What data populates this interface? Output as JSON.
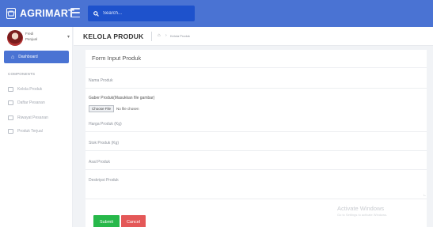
{
  "brand": {
    "name": "AGRIMART"
  },
  "search": {
    "placeholder": "Search..."
  },
  "user": {
    "name": "Fredi",
    "role": "Penjual"
  },
  "sidebar": {
    "active_item": "Dashboard",
    "section_label": "COMPONENTS",
    "items": [
      {
        "label": "Kelola Produk",
        "icon": "box-icon"
      },
      {
        "label": "Daftar Pesanan",
        "icon": "list-icon"
      },
      {
        "label": "Riwayat Pesanan",
        "icon": "history-icon"
      },
      {
        "label": "Produk Terjual",
        "icon": "sold-icon"
      }
    ]
  },
  "header": {
    "title": "KELOLA PRODUK",
    "breadcrumb": "Kelola Produk"
  },
  "form": {
    "title": "Form Input Produk",
    "fields": {
      "nama": "Nama Produk",
      "gambar": "Gaber Produk(Masukkan file gambar)",
      "file_button": "Choose File",
      "file_status": "No file chosen",
      "harga": "Harga Produk (Kg)",
      "stok": "Stok Produk (Kg)",
      "asal": "Asal Produk",
      "deskripsi": "Deskripsi Produk"
    },
    "submit_label": "Submit",
    "cancel_label": "Cancel"
  },
  "watermark": {
    "title": "Activate Windows",
    "subtitle": "Go to Settings to activate Windows."
  },
  "colors": {
    "topbar": "#4a73d3",
    "search_bg": "#1e52cc",
    "submit": "#27b84a",
    "cancel": "#e45858"
  }
}
